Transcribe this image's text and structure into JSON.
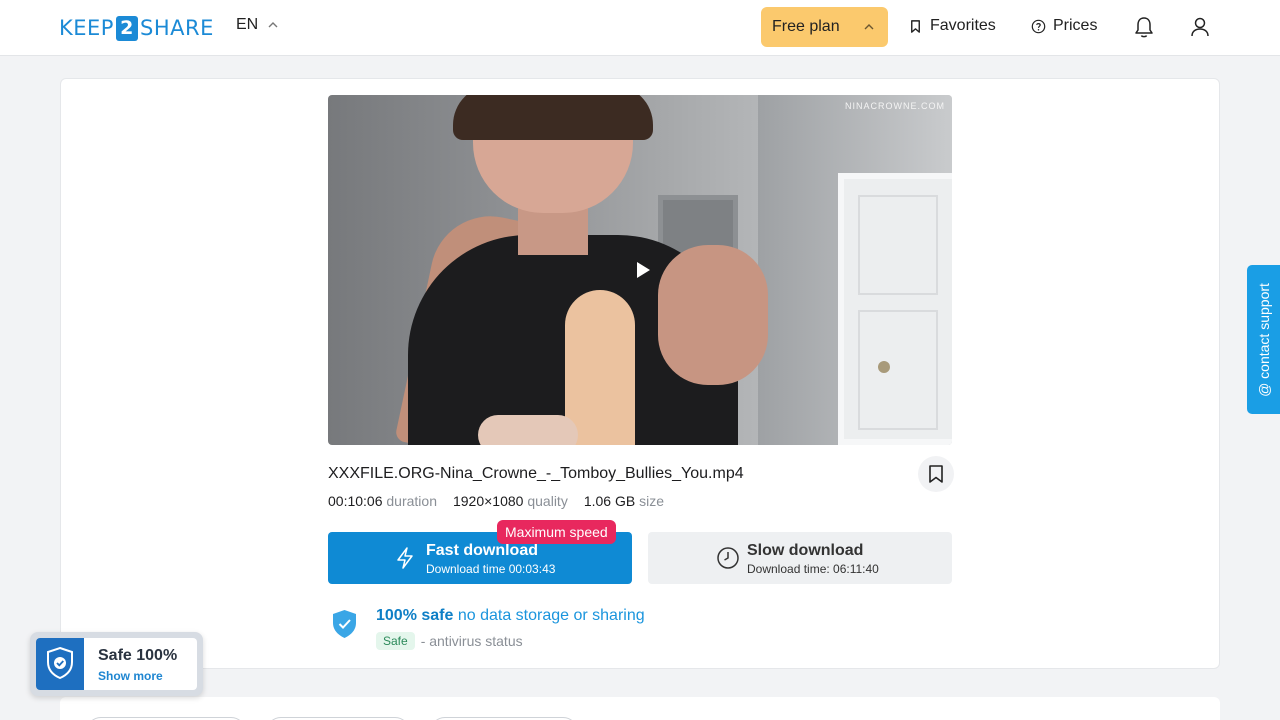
{
  "header": {
    "logo_left": "KEEP",
    "logo_middle": "2",
    "logo_right": "SHARE",
    "language": "EN",
    "plan_label": "Free plan",
    "favorites_label": "Favorites",
    "prices_label": "Prices"
  },
  "video": {
    "watermark": "NINACROWNE.COM"
  },
  "file": {
    "name": "XXXFILE.ORG-Nina_Crowne_-_Tomboy_Bullies_You.mp4",
    "duration_value": "00:10:06",
    "duration_label": "duration",
    "quality_value": "1920×1080",
    "quality_label": "quality",
    "size_value": "1.06 GB",
    "size_label": "size"
  },
  "download": {
    "fast_title": "Fast download",
    "fast_time": "Download time 00:03:43",
    "badge": "Maximum speed",
    "slow_title": "Slow download",
    "slow_time": "Download time: 06:11:40"
  },
  "safety": {
    "headline_strong": "100% safe",
    "headline_rest": "no data storage or sharing",
    "tag": "Safe",
    "antivirus": "- antivirus status"
  },
  "safe_badge": {
    "title": "Safe 100%",
    "link": "Show more"
  },
  "support": {
    "label": "@ contact support"
  },
  "colors": {
    "brand": "#1b8ad6",
    "plan": "#fbc96d",
    "fast": "#0f8ad4",
    "max_speed": "#e8285e",
    "support": "#1a9ee5"
  }
}
